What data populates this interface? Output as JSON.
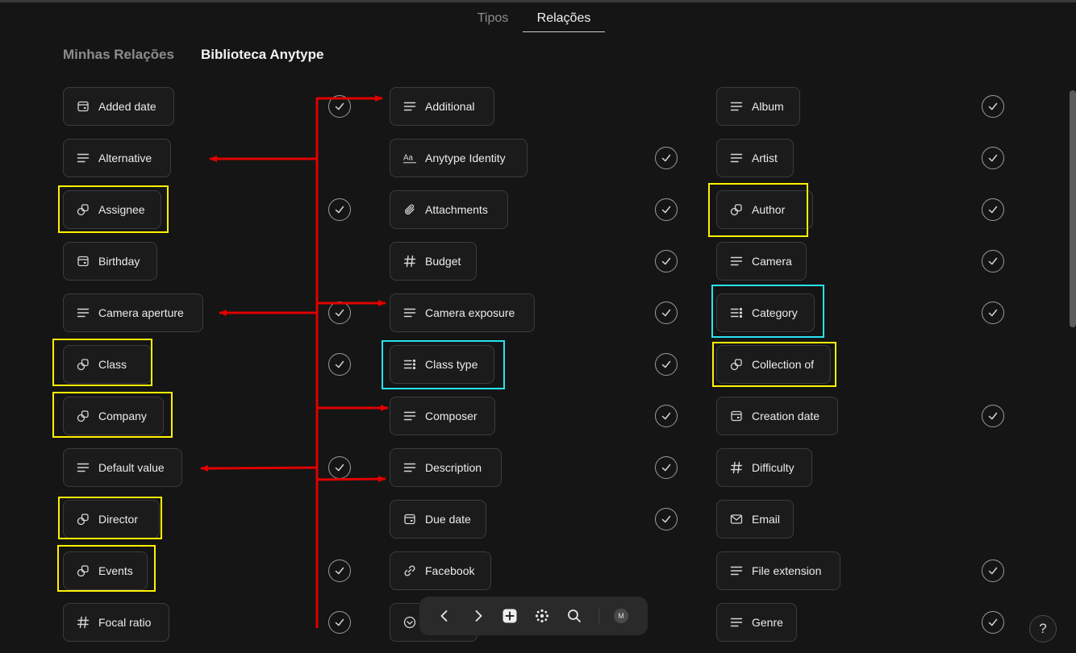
{
  "tabs": [
    {
      "label": "Tipos",
      "active": false
    },
    {
      "label": "Relações",
      "active": true
    }
  ],
  "subtabs": {
    "mine": "Minhas Relações",
    "library": "Biblioteca Anytype"
  },
  "relations": {
    "col1": [
      {
        "label": "Added date",
        "icon": "calendar-icon",
        "checked": true
      },
      {
        "label": "Alternative",
        "icon": "text-lines-icon",
        "checked": false
      },
      {
        "label": "Assignee",
        "icon": "object-shapes-icon",
        "checked": true
      },
      {
        "label": "Birthday",
        "icon": "calendar-icon",
        "checked": false
      },
      {
        "label": "Camera aperture",
        "icon": "text-lines-icon",
        "checked": true
      },
      {
        "label": "Class",
        "icon": "object-shapes-icon",
        "checked": true
      },
      {
        "label": "Company",
        "icon": "object-shapes-icon",
        "checked": false
      },
      {
        "label": "Default value",
        "icon": "text-lines-icon",
        "checked": true
      },
      {
        "label": "Director",
        "icon": "object-shapes-icon",
        "checked": false
      },
      {
        "label": "Events",
        "icon": "object-shapes-icon",
        "checked": true
      },
      {
        "label": "Focal ratio",
        "icon": "hash-icon",
        "checked": true
      }
    ],
    "col2": [
      {
        "label": "Additional",
        "icon": "text-lines-icon",
        "checked": false
      },
      {
        "label": "Anytype Identity",
        "icon": "text-aa-icon",
        "checked": true
      },
      {
        "label": "Attachments",
        "icon": "paperclip-icon",
        "checked": true
      },
      {
        "label": "Budget",
        "icon": "hash-icon",
        "checked": true
      },
      {
        "label": "Camera exposure",
        "icon": "text-lines-icon",
        "checked": true
      },
      {
        "label": "Class type",
        "icon": "select-list-icon",
        "checked": true
      },
      {
        "label": "Composer",
        "icon": "text-lines-icon",
        "checked": true
      },
      {
        "label": "Description",
        "icon": "text-lines-icon",
        "checked": true
      },
      {
        "label": "Due date",
        "icon": "calendar-icon",
        "checked": true
      },
      {
        "label": "Facebook",
        "icon": "link-icon",
        "checked": false
      },
      {
        "label": "",
        "icon": "chevron-circle-icon",
        "checked": false
      }
    ],
    "col3": [
      {
        "label": "Album",
        "icon": "text-lines-icon",
        "checked": true
      },
      {
        "label": "Artist",
        "icon": "text-lines-icon",
        "checked": true
      },
      {
        "label": "Author",
        "icon": "object-shapes-icon",
        "checked": true
      },
      {
        "label": "Camera",
        "icon": "text-lines-icon",
        "checked": true
      },
      {
        "label": "Category",
        "icon": "select-list-icon",
        "checked": true
      },
      {
        "label": "Collection of",
        "icon": "object-shapes-icon",
        "checked": false
      },
      {
        "label": "Creation date",
        "icon": "calendar-icon",
        "checked": true
      },
      {
        "label": "Difficulty",
        "icon": "hash-icon",
        "checked": false
      },
      {
        "label": "Email",
        "icon": "mail-icon",
        "checked": false
      },
      {
        "label": "File extension",
        "icon": "text-lines-icon",
        "checked": true
      },
      {
        "label": "Genre",
        "icon": "text-lines-icon",
        "checked": true
      }
    ]
  },
  "annotation_colors": {
    "yellow": "#fff200",
    "cyan": "#27e3ee",
    "arrow": "#e00000"
  },
  "navbar": {
    "icons": [
      "back-arrow-icon",
      "forward-arrow-icon",
      "plus-square-icon",
      "graph-dots-icon",
      "search-icon"
    ],
    "avatar_initial": "M"
  },
  "help_label": "?"
}
